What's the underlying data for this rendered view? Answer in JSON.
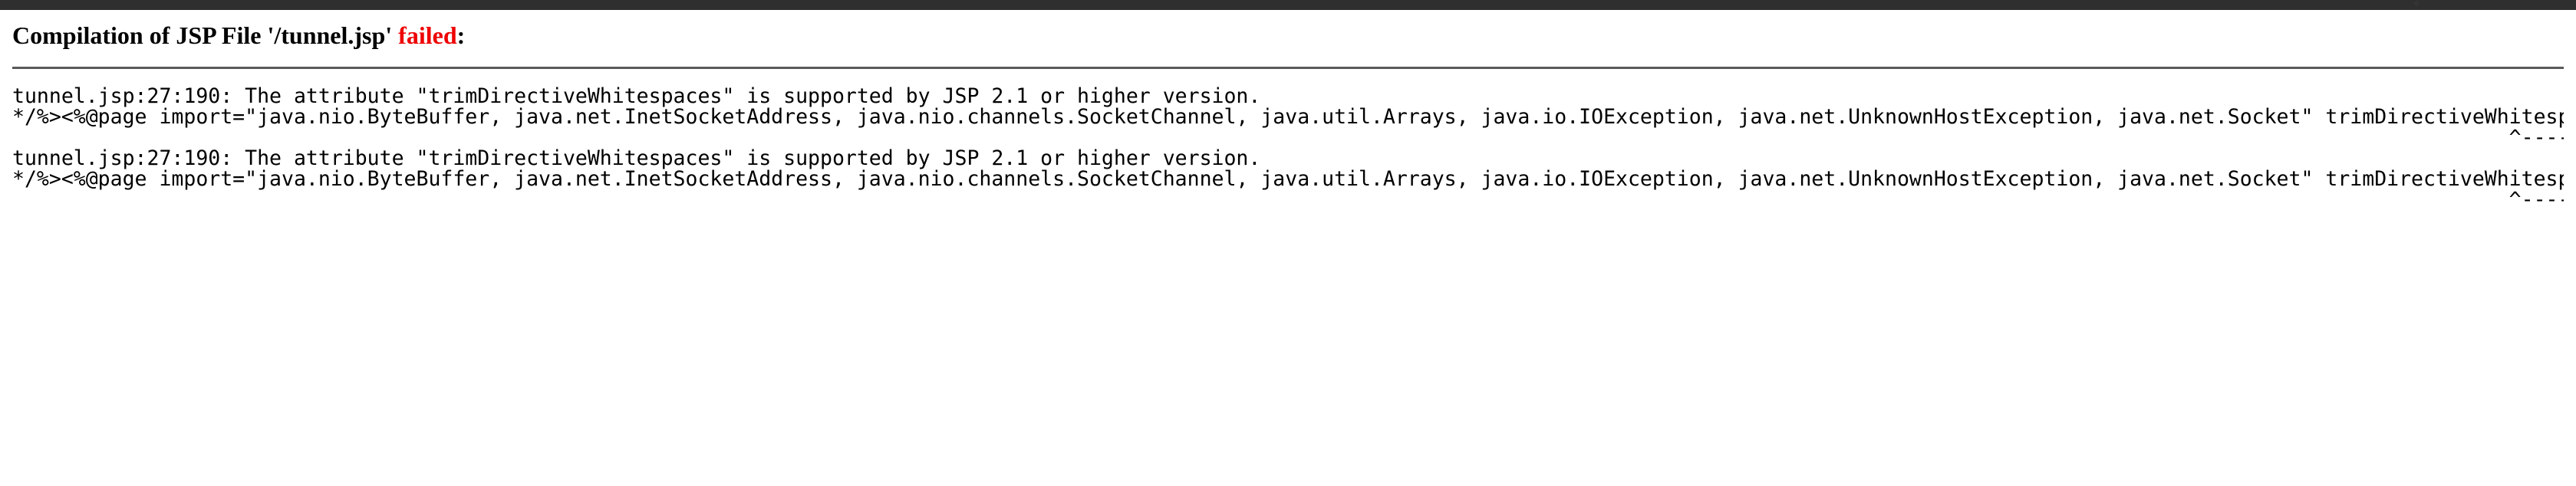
{
  "header": {
    "title_prefix": "Compilation of JSP File '/tunnel.jsp' ",
    "title_status": "failed",
    "title_suffix": ":"
  },
  "errors": [
    {
      "message": "tunnel.jsp:27:190: The attribute \"trimDirectiveWhitespaces\" is supported by JSP 2.1 or higher version.",
      "source": "*/%><%@page import=\"java.nio.ByteBuffer, java.net.InetSocketAddress, java.nio.channels.SocketChannel, java.util.Arrays, java.io.IOException, java.net.UnknownHostException, java.net.Socket\" trimDirectiveWhitespaces=",
      "marker": "                                                                                                                                                                                                            ^----------------------^"
    },
    {
      "message": "tunnel.jsp:27:190: The attribute \"trimDirectiveWhitespaces\" is supported by JSP 2.1 or higher version.",
      "source": "*/%><%@page import=\"java.nio.ByteBuffer, java.net.InetSocketAddress, java.nio.channels.SocketChannel, java.util.Arrays, java.io.IOException, java.net.UnknownHostException, java.net.Socket\" trimDirectiveWhitespaces=",
      "marker": "                                                                                                                                                                                                            ^----------------------^"
    }
  ]
}
